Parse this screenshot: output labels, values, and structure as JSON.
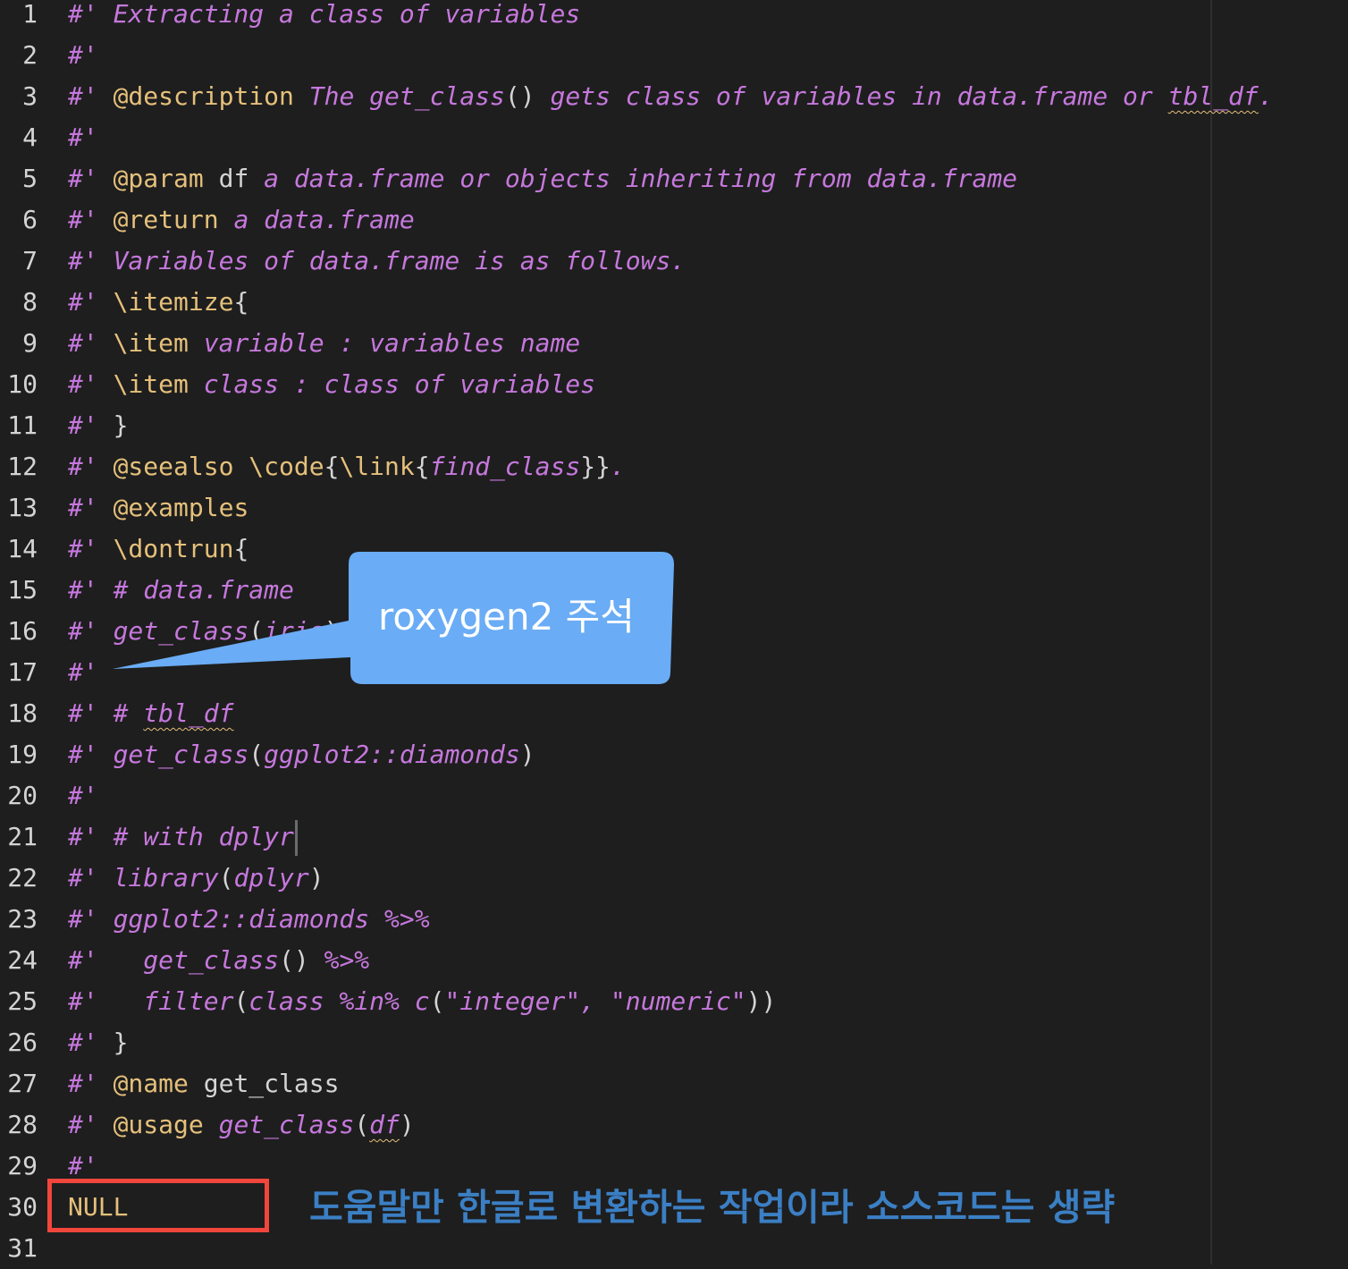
{
  "editor": {
    "lines": [
      {
        "n": "1",
        "segs": [
          {
            "t": "#' Extracting a class of variables",
            "c": "c"
          }
        ]
      },
      {
        "n": "2",
        "segs": [
          {
            "t": "#'",
            "c": "c"
          }
        ]
      },
      {
        "n": "3",
        "segs": [
          {
            "t": "#' ",
            "c": "c"
          },
          {
            "t": "@description",
            "c": "t"
          },
          {
            "t": " The get_class",
            "c": "c"
          },
          {
            "t": "()",
            "c": "p"
          },
          {
            "t": " gets class of variables in data.frame or ",
            "c": "c"
          },
          {
            "t": "tbl_df",
            "c": "c squig"
          },
          {
            "t": ".",
            "c": "c"
          }
        ]
      },
      {
        "n": "4",
        "segs": [
          {
            "t": "#'",
            "c": "c"
          }
        ]
      },
      {
        "n": "5",
        "segs": [
          {
            "t": "#' ",
            "c": "c"
          },
          {
            "t": "@param",
            "c": "t"
          },
          {
            "t": " df ",
            "c": "p"
          },
          {
            "t": "a data.frame or objects inheriting from data.frame",
            "c": "c"
          }
        ]
      },
      {
        "n": "6",
        "segs": [
          {
            "t": "#' ",
            "c": "c"
          },
          {
            "t": "@return",
            "c": "t"
          },
          {
            "t": " a data.frame",
            "c": "c"
          }
        ]
      },
      {
        "n": "7",
        "segs": [
          {
            "t": "#' Variables of data.frame is as follows.",
            "c": "c"
          }
        ]
      },
      {
        "n": "8",
        "segs": [
          {
            "t": "#' ",
            "c": "c"
          },
          {
            "t": "\\itemize",
            "c": "t"
          },
          {
            "t": "{",
            "c": "p"
          }
        ]
      },
      {
        "n": "9",
        "segs": [
          {
            "t": "#' ",
            "c": "c"
          },
          {
            "t": "\\item",
            "c": "t"
          },
          {
            "t": " variable : variables name",
            "c": "c"
          }
        ]
      },
      {
        "n": "10",
        "segs": [
          {
            "t": "#' ",
            "c": "c"
          },
          {
            "t": "\\item",
            "c": "t"
          },
          {
            "t": " class : class of variables",
            "c": "c"
          }
        ]
      },
      {
        "n": "11",
        "segs": [
          {
            "t": "#' ",
            "c": "c"
          },
          {
            "t": "}",
            "c": "p"
          }
        ]
      },
      {
        "n": "12",
        "segs": [
          {
            "t": "#' ",
            "c": "c"
          },
          {
            "t": "@seealso",
            "c": "t"
          },
          {
            "t": " \\code",
            "c": "t"
          },
          {
            "t": "{",
            "c": "p"
          },
          {
            "t": "\\link",
            "c": "t"
          },
          {
            "t": "{",
            "c": "p"
          },
          {
            "t": "find_class",
            "c": "c"
          },
          {
            "t": "}}",
            "c": "p"
          },
          {
            "t": ".",
            "c": "c"
          }
        ]
      },
      {
        "n": "13",
        "segs": [
          {
            "t": "#' ",
            "c": "c"
          },
          {
            "t": "@examples",
            "c": "t"
          }
        ]
      },
      {
        "n": "14",
        "segs": [
          {
            "t": "#' ",
            "c": "c"
          },
          {
            "t": "\\dontrun",
            "c": "t"
          },
          {
            "t": "{",
            "c": "p"
          }
        ]
      },
      {
        "n": "15",
        "segs": [
          {
            "t": "#' # data.frame",
            "c": "c"
          }
        ]
      },
      {
        "n": "16",
        "segs": [
          {
            "t": "#' get_class",
            "c": "c"
          },
          {
            "t": "(",
            "c": "p"
          },
          {
            "t": "iris",
            "c": "c"
          },
          {
            "t": ")",
            "c": "p"
          }
        ]
      },
      {
        "n": "17",
        "segs": [
          {
            "t": "#'",
            "c": "c"
          }
        ]
      },
      {
        "n": "18",
        "segs": [
          {
            "t": "#' # ",
            "c": "c"
          },
          {
            "t": "tbl_df",
            "c": "c squig"
          }
        ]
      },
      {
        "n": "19",
        "segs": [
          {
            "t": "#' get_class",
            "c": "c"
          },
          {
            "t": "(",
            "c": "p"
          },
          {
            "t": "ggplot2::diamonds",
            "c": "c"
          },
          {
            "t": ")",
            "c": "p"
          }
        ]
      },
      {
        "n": "20",
        "segs": [
          {
            "t": "#'",
            "c": "c"
          }
        ]
      },
      {
        "n": "21",
        "segs": [
          {
            "t": "#' # with dplyr",
            "c": "c"
          }
        ],
        "cursor": true
      },
      {
        "n": "22",
        "segs": [
          {
            "t": "#' library",
            "c": "c"
          },
          {
            "t": "(",
            "c": "p"
          },
          {
            "t": "dplyr",
            "c": "c"
          },
          {
            "t": ")",
            "c": "p"
          }
        ]
      },
      {
        "n": "23",
        "segs": [
          {
            "t": "#' ggplot2::diamonds %>%",
            "c": "c"
          }
        ]
      },
      {
        "n": "24",
        "segs": [
          {
            "t": "#'   get_class",
            "c": "c"
          },
          {
            "t": "()",
            "c": "p"
          },
          {
            "t": " %>%",
            "c": "c"
          }
        ]
      },
      {
        "n": "25",
        "segs": [
          {
            "t": "#'   filter",
            "c": "c"
          },
          {
            "t": "(",
            "c": "p"
          },
          {
            "t": "class %in% c",
            "c": "c"
          },
          {
            "t": "(",
            "c": "p"
          },
          {
            "t": "\"integer\", \"numeric\"",
            "c": "c"
          },
          {
            "t": "))",
            "c": "p"
          }
        ]
      },
      {
        "n": "26",
        "segs": [
          {
            "t": "#' ",
            "c": "c"
          },
          {
            "t": "}",
            "c": "p"
          }
        ]
      },
      {
        "n": "27",
        "segs": [
          {
            "t": "#' ",
            "c": "c"
          },
          {
            "t": "@name",
            "c": "t"
          },
          {
            "t": " get_class",
            "c": "p"
          }
        ]
      },
      {
        "n": "28",
        "segs": [
          {
            "t": "#' ",
            "c": "c"
          },
          {
            "t": "@usage",
            "c": "t"
          },
          {
            "t": " get_class",
            "c": "c"
          },
          {
            "t": "(",
            "c": "p"
          },
          {
            "t": "df",
            "c": "c squig"
          },
          {
            "t": ")",
            "c": "p"
          }
        ]
      },
      {
        "n": "29",
        "segs": [
          {
            "t": "#'",
            "c": "c"
          }
        ]
      },
      {
        "n": "30",
        "segs": [
          {
            "t": "NULL",
            "c": "null-text"
          }
        ]
      },
      {
        "n": "31",
        "segs": []
      }
    ]
  },
  "annotations": {
    "callout_text": "roxygen2 주석",
    "note_text": "도움말만 한글로 변환하는 작업이라 소스코드는 생략"
  },
  "colors": {
    "background": "#1e1e1e",
    "comment": "#c678dd",
    "tag": "#e5c07b",
    "callout": "#6aacf5",
    "highlight_box": "#f0463c",
    "note": "#3b7fc4"
  }
}
